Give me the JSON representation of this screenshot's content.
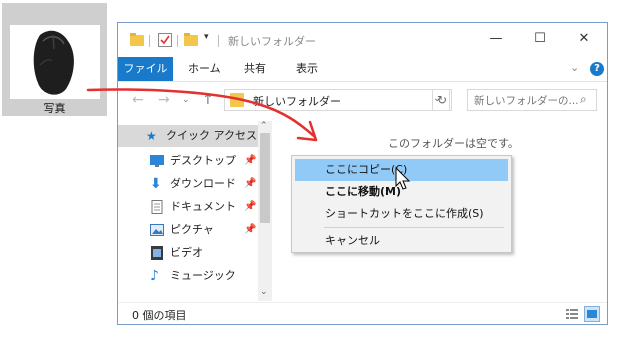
{
  "desktop": {
    "icon_label": "写真"
  },
  "window": {
    "title": "新しいフォルダー",
    "ribbon_tabs": [
      "ファイル",
      "ホーム",
      "共有",
      "表示"
    ],
    "help_glyph": "?",
    "address": "新しいフォルダー",
    "search_placeholder": "新しいフォルダーの...",
    "nav_items": [
      {
        "label": "クイック アクセス",
        "icon": "star-icon",
        "selected": true
      },
      {
        "label": "デスクトップ",
        "icon": "desktop-icon",
        "pinned": true
      },
      {
        "label": "ダウンロード",
        "icon": "download-icon",
        "pinned": true
      },
      {
        "label": "ドキュメント",
        "icon": "document-icon",
        "pinned": true
      },
      {
        "label": "ピクチャ",
        "icon": "pictures-icon",
        "pinned": true
      },
      {
        "label": "ビデオ",
        "icon": "video-icon"
      },
      {
        "label": "ミュージック",
        "icon": "music-icon"
      }
    ],
    "empty_message": "このフォルダーは空です。",
    "status": "0 個の項目"
  },
  "context_menu": {
    "items": [
      {
        "label": "ここにコピー(C)",
        "highlighted": true
      },
      {
        "label": "ここに移動(M)"
      },
      {
        "label": "ショートカットをここに作成(S)"
      },
      {
        "label": "キャンセル"
      }
    ]
  },
  "colors": {
    "accent": "#1979ca",
    "drag_line": "#e53030",
    "menu_highlight": "#91c9f7",
    "folder": "#f3c74b"
  }
}
